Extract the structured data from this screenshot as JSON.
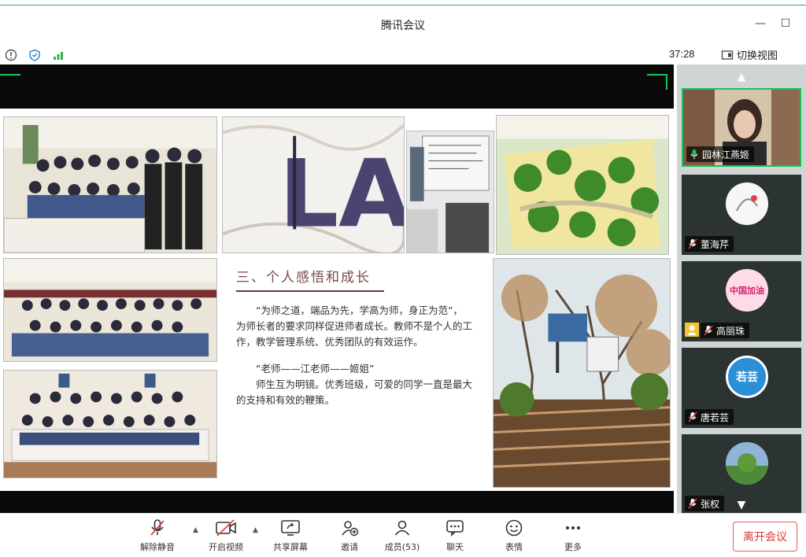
{
  "window": {
    "title": "腾讯会议"
  },
  "status": {
    "timer": "37:28",
    "switch_view_label": "切换视图"
  },
  "slide": {
    "heading": "三、个人感悟和成长",
    "paragraphs": [
      "“为师之道，端品为先，学高为师，身正为范”，为师长者的要求同样促进师者成长。教师不是个人的工作，教学管理系统、优秀团队的有效运作。",
      "“老师——江老师——姬姐”",
      "师生互为明镜。优秀班级，可爱的同学一直是最大的支持和有效的鞭策。"
    ],
    "photo_letters": "LA"
  },
  "participants": [
    {
      "name": "园林江燕姬",
      "mic": "on",
      "active": true
    },
    {
      "name": "董海芹",
      "mic": "off"
    },
    {
      "name": "高丽珠",
      "mic": "off",
      "avatar_text": "中国加油"
    },
    {
      "name": "唐若芸",
      "mic": "off",
      "avatar_text": "若芸"
    },
    {
      "name": "张权",
      "mic": "off"
    }
  ],
  "toolbar": {
    "unmute": "解除静音",
    "start_video": "开启视频",
    "share_screen": "共享屏幕",
    "invite": "邀请",
    "members": "成员(53)",
    "chat": "聊天",
    "emoji": "表情",
    "more": "更多",
    "leave": "离开会议"
  },
  "colors": {
    "accent": "#1fc05a",
    "leave": "#d33333",
    "mic_off": "#e04040"
  }
}
